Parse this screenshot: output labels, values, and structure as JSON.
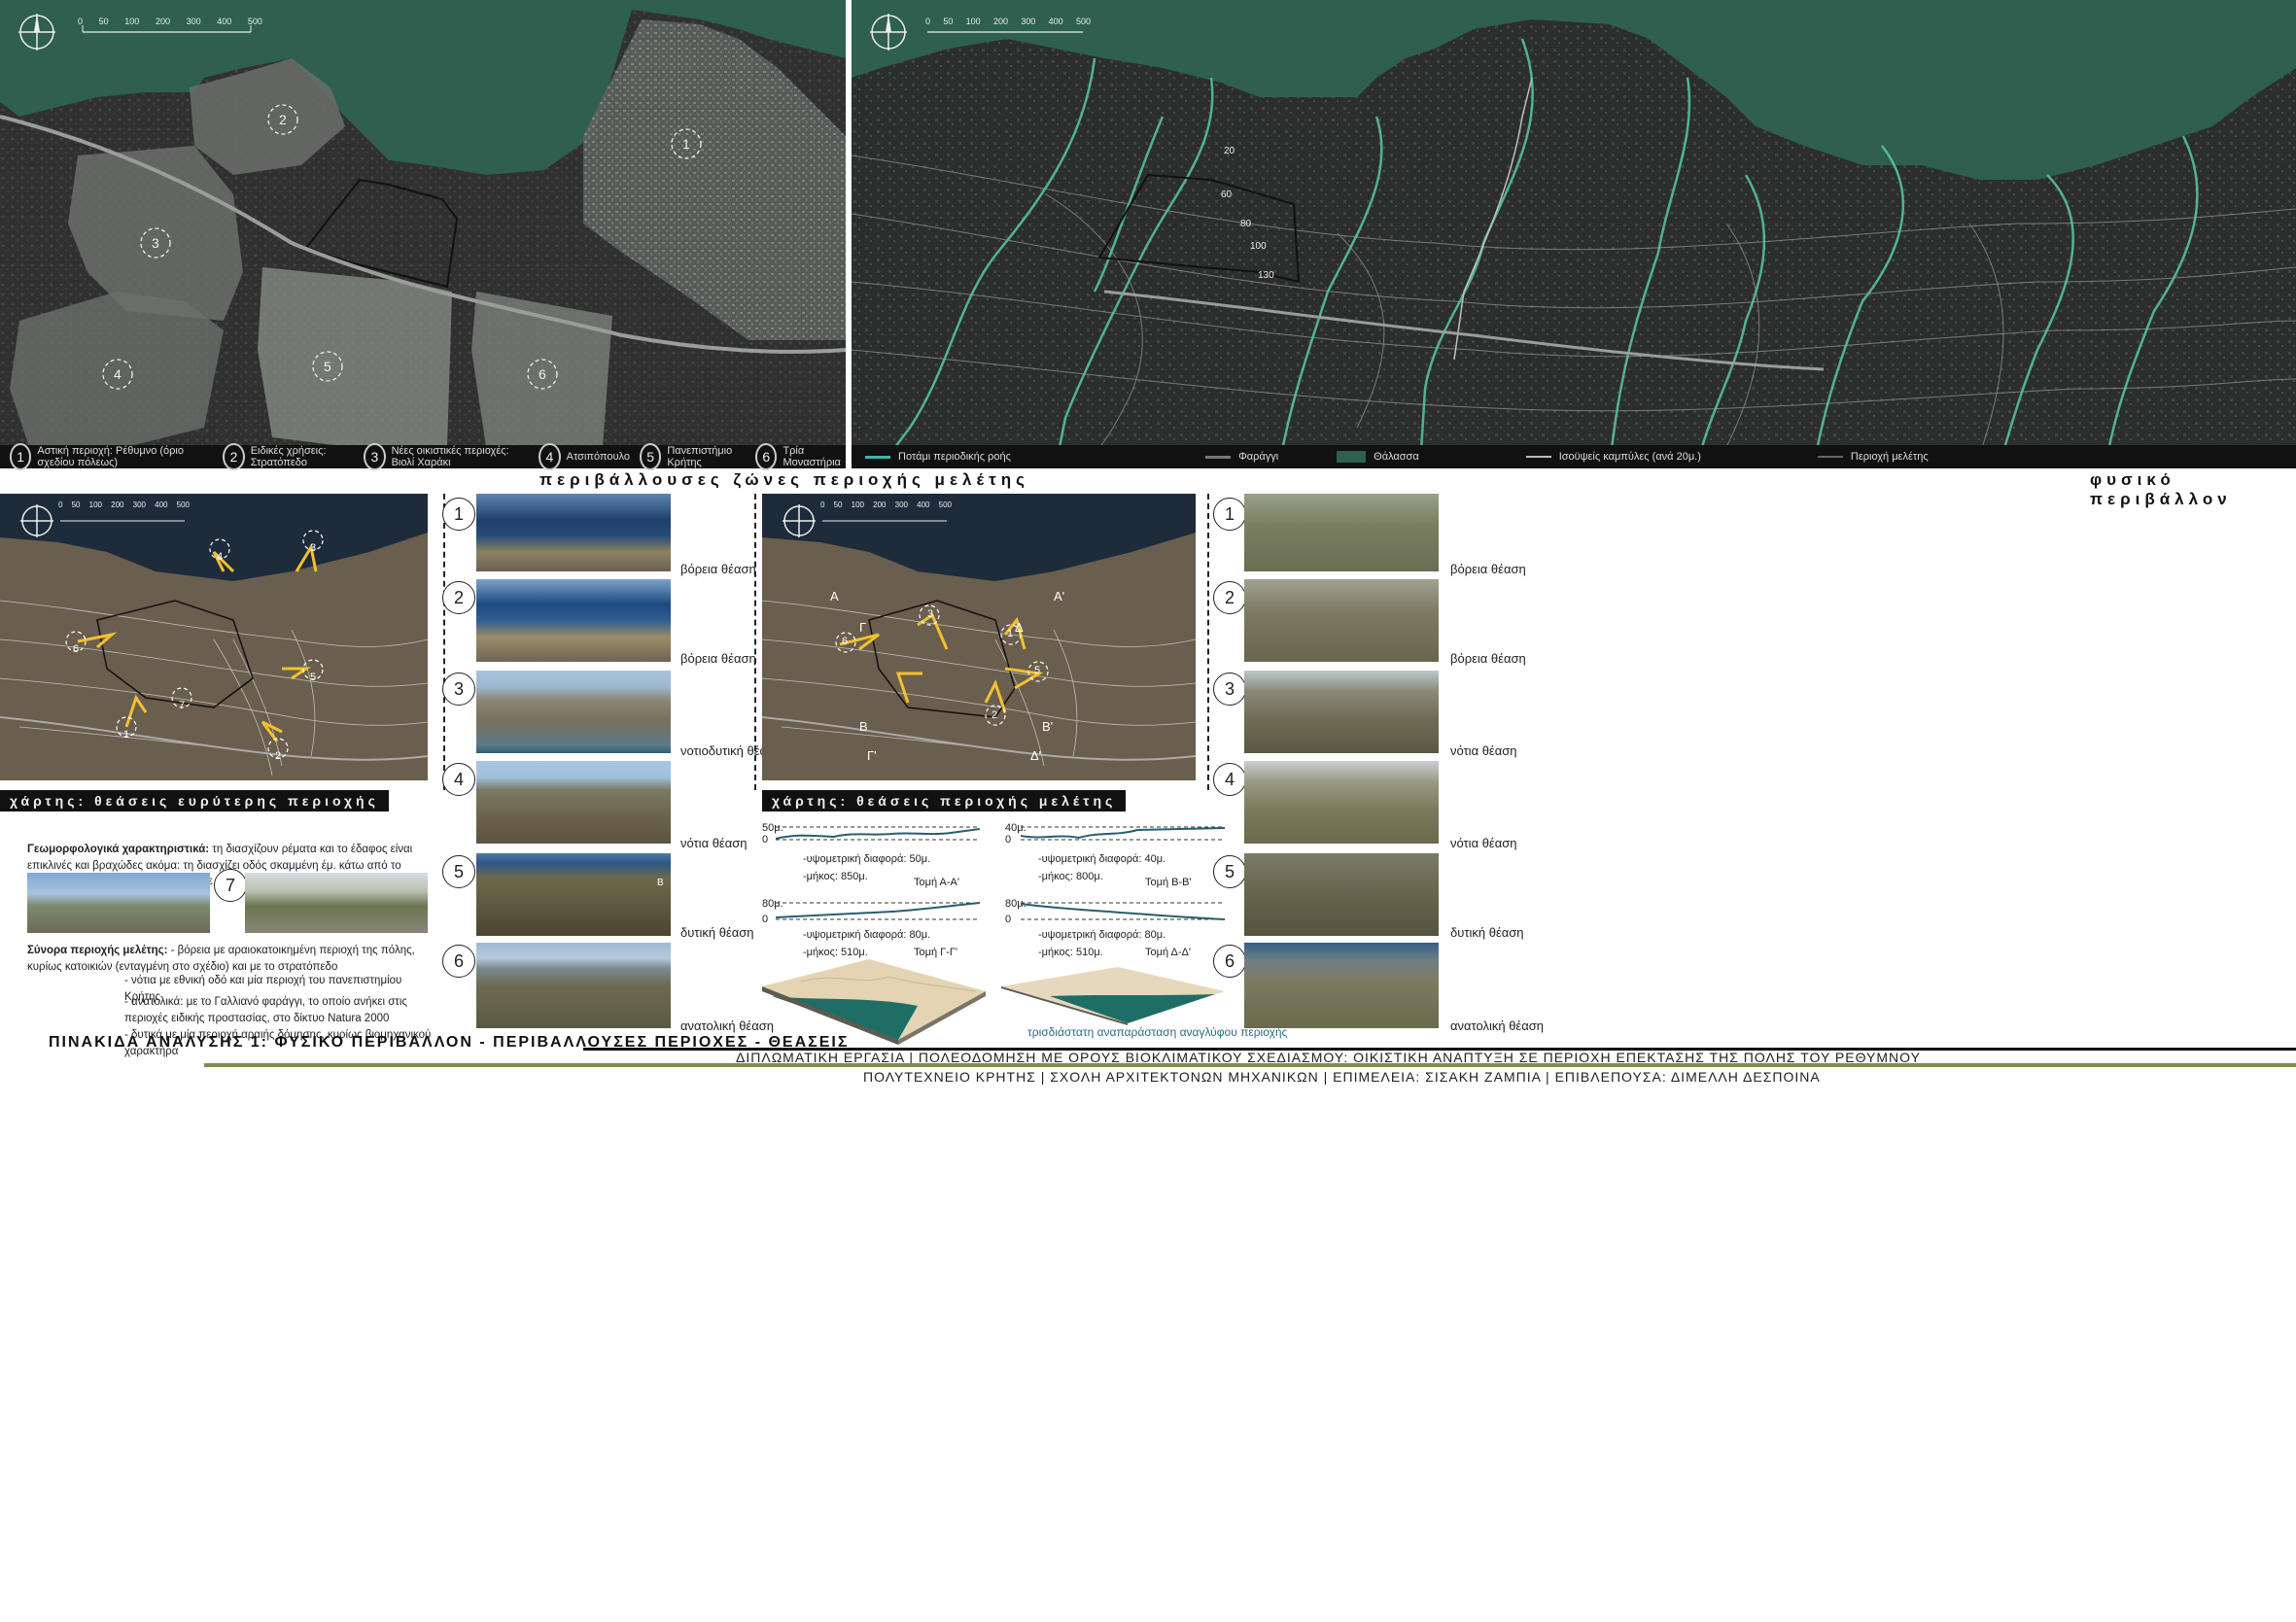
{
  "top_left": {
    "scale_ticks": [
      "0",
      "50",
      "100",
      "200",
      "300",
      "400",
      "500"
    ],
    "zone_markers": [
      "1",
      "2",
      "3",
      "4",
      "5",
      "6"
    ],
    "legend": [
      {
        "num": "1",
        "text": "Αστική περιοχή: Ρέθυμνο (όριο σχεδίου πόλεως)"
      },
      {
        "num": "2",
        "text": "Ειδικές χρήσεις: Στρατόπεδο"
      },
      {
        "num": "3",
        "text": "Νέες οικιστικές περιοχές: Βιολί Χαράκι"
      },
      {
        "num": "4",
        "text": "Ατσιπόπουλο"
      },
      {
        "num": "5",
        "text": "Πανεπιστήμιο Κρήτης"
      },
      {
        "num": "6",
        "text": "Τρία Μοναστήρια"
      }
    ],
    "title": "περιβάλλουσες ζώνες περιοχής μελέτης"
  },
  "top_right": {
    "scale_ticks": [
      "0",
      "50",
      "100",
      "200",
      "300",
      "400",
      "500"
    ],
    "contour_labels": [
      "20",
      "60",
      "80",
      "100",
      "130"
    ],
    "legend": [
      {
        "text": "Ποτάμι περιοδικής ροής",
        "color": "#3fb6a8"
      },
      {
        "text": "Φαράγγι",
        "color": "#777777"
      },
      {
        "text": "Θάλασσα",
        "color": "#2e5f4f"
      },
      {
        "text": "Ισοϋψείς καμπύλες (ανά 20μ.)",
        "color": "#bbbbbb"
      },
      {
        "text": "Περιοχή μελέτης",
        "color": "#222222"
      }
    ],
    "title": "φυσικό περιβάλλον"
  },
  "mid_left": {
    "scale_ticks": [
      "0",
      "50",
      "100",
      "200",
      "300",
      "400",
      "500"
    ],
    "view_points": [
      "1",
      "2",
      "3",
      "4",
      "5",
      "6",
      "7"
    ],
    "caption": "χάρτης: θεάσεις ευρύτερης περιοχής",
    "photos": [
      {
        "num": "1",
        "label": "βόρεια θέαση"
      },
      {
        "num": "2",
        "label": "βόρεια θέαση"
      },
      {
        "num": "3",
        "label": "νοτιοδυτική θέαση"
      },
      {
        "num": "4",
        "label": "νότια θέαση"
      },
      {
        "num": "5",
        "label": "δυτική θέαση"
      },
      {
        "num": "6",
        "label": "ανατολική θέαση"
      }
    ],
    "marker_b": "B",
    "geomorph_title": "Γεωμορφολογικά χαρακτηριστικά:",
    "geomorph_text": " τη διασχίζουν ρέματα και το έδαφος είναι επικλινές και βραχώδες ακόμα: τη διασχίζει οδός σκαμμένη έμ. κάτω από το φυσικό ύψος του εδάφους - ένωση με γέφυρα(εθνική οδός)",
    "photo7_num": "7",
    "borders_title": "Σύνορα περιοχής μελέτης:",
    "borders_lines": [
      " - βόρεια με αραιοκατοικημένη περιοχή της πόλης, κυρίως κατοικιών (ενταγμένη στο σχέδιο) και με το στρατόπεδο",
      "- νότια με εθνική οδό και μία περιοχή του πανεπιστημίου Κρήτης",
      "- ανατολικά: με το Γαλλιανό φαράγγι, το οποίο ανήκει στις περιοχές ειδικής προστασίας, στο δίκτυο Natura 2000",
      "- δυτικά με μία περιοχή αραιής δόμησης, κυρίως βιομηχανικού χαρακτήρα"
    ]
  },
  "mid_right": {
    "scale_ticks": [
      "0",
      "50",
      "100",
      "200",
      "300",
      "400",
      "500"
    ],
    "view_points": [
      "1",
      "2",
      "3",
      "4",
      "5",
      "6"
    ],
    "section_letters": [
      "A",
      "A'",
      "B",
      "B'",
      "Γ",
      "Γ'",
      "Δ",
      "Δ'"
    ],
    "caption": "χάρτης: θεάσεις περιοχής μελέτης",
    "photos": [
      {
        "num": "1",
        "label": "βόρεια θέαση"
      },
      {
        "num": "2",
        "label": "βόρεια θέαση"
      },
      {
        "num": "3",
        "label": "νότια θέαση"
      },
      {
        "num": "4",
        "label": "νότια θέαση"
      },
      {
        "num": "5",
        "label": "δυτική θέαση"
      },
      {
        "num": "6",
        "label": "ανατολική θέαση"
      }
    ],
    "sections": [
      {
        "top": "50μ.",
        "zero": "0",
        "diff": "-υψομετρική διαφορά: 50μ.",
        "len": "-μήκος: 850μ.",
        "name": "Τομή Α-Α'"
      },
      {
        "top": "40μ.",
        "zero": "0",
        "diff": "-υψομετρική διαφορά: 40μ.",
        "len": "-μήκος: 800μ.",
        "name": "Τομή Β-Β'"
      },
      {
        "top": "80μ.",
        "zero": "0",
        "diff": "-υψομετρική διαφορά: 80μ.",
        "len": "-μήκος: 510μ.",
        "name": "Τομή Γ-Γ'"
      },
      {
        "top": "80μ.",
        "zero": "0",
        "diff": "-υψομετρική διαφορά: 80μ.",
        "len": "-μήκος: 510μ.",
        "name": "Τομή Δ-Δ'"
      }
    ],
    "relief_caption": "τρισδιάστατη αναπαράσταση αναγλύφου περιοχής"
  },
  "footer": {
    "board_title": "ΠΙΝΑΚΙΔΑ ΑΝΑΛΥΣΗΣ 1: ΦΥΣΙΚΟ ΠΕΡΙΒΑΛΛΟΝ - ΠΕΡΙΒΑΛΛΟΥΣΕΣ ΠΕΡΙΟΧΕΣ - ΘΕΑΣΕΙΣ",
    "thesis_line": "ΔΙΠΛΩΜΑΤΙΚΗ ΕΡΓΑΣΙΑ | ΠΟΛΕΟΔΟΜΗΣΗ ΜΕ ΟΡΟΥΣ ΒΙΟΚΛΙΜΑΤΙΚΟΥ ΣΧΕΔΙΑΣΜΟΥ: ΟΙΚΙΣΤΙΚΗ ΑΝΑΠΤΥΞΗ ΣΕ ΠΕΡΙΟΧΗ ΕΠΕΚΤΑΣΗΣ ΤΗΣ ΠΟΛΗΣ ΤΟΥ ΡΕΘΥΜΝΟΥ",
    "school_line": "ΠΟΛΥΤΕΧΝΕΙΟ ΚΡΗΤΗΣ | ΣΧΟΛΗ ΑΡΧΙΤΕΚΤΟΝΩΝ ΜΗΧΑΝΙΚΩΝ | ΕΠΙΜΕΛΕΙΑ: ΣΙΣΑΚΗ ΖΑΜΠΙΑ | ΕΠΙΒΛΕΠΟΥΣΑ: ΔΙΜΕΛΛΗ ΔΕΣΠΟΙΝΑ"
  }
}
